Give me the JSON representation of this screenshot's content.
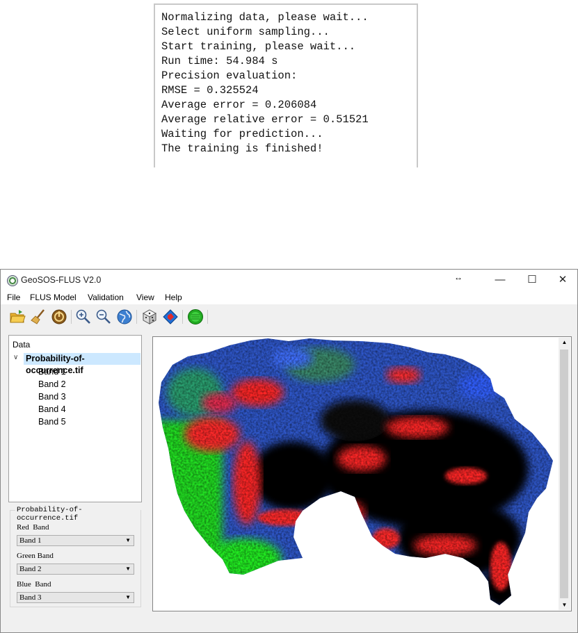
{
  "console": {
    "lines": [
      "Normalizing data, please wait...",
      "Select uniform sampling...",
      "Start training, please wait...",
      "Run time: 54.984 s",
      "Precision evaluation:",
      "RMSE = 0.325524",
      "Average error = 0.206084",
      "Average relative error = 0.51521",
      "Waiting for prediction...",
      "The training is finished!"
    ]
  },
  "window": {
    "title": "GeoSOS-FLUS V2.0",
    "minimize": "—",
    "maximize": "☐",
    "close": "✕",
    "resize_glyph": "↔"
  },
  "menu": [
    "File",
    "FLUS Model",
    "Validation",
    "View",
    "Help"
  ],
  "toolbar": {
    "icons": [
      "open-folder-icon",
      "broom-clear-icon",
      "power-icon",
      "zoom-in-icon",
      "zoom-out-icon",
      "globe-icon",
      "dice-icon",
      "layers-icon",
      "start-icon"
    ]
  },
  "tree": {
    "header": "Data",
    "root": "Probability-of-occurrence.tif",
    "bands": [
      "Band 1",
      "Band 2",
      "Band 3",
      "Band 4",
      "Band 5"
    ]
  },
  "band_group": {
    "title": "Probability-of-occurrence.tif",
    "red_label": "Red  Band",
    "red_value": "Band 1",
    "green_label": "Green Band",
    "green_value": "Band 2",
    "blue_label": "Blue  Band",
    "blue_value": "Band 3"
  },
  "colors": {
    "map_black": "#000000",
    "map_red": "#ff2020",
    "map_green": "#20ff20",
    "map_blue": "#3060ff",
    "selection": "#cce8ff"
  }
}
